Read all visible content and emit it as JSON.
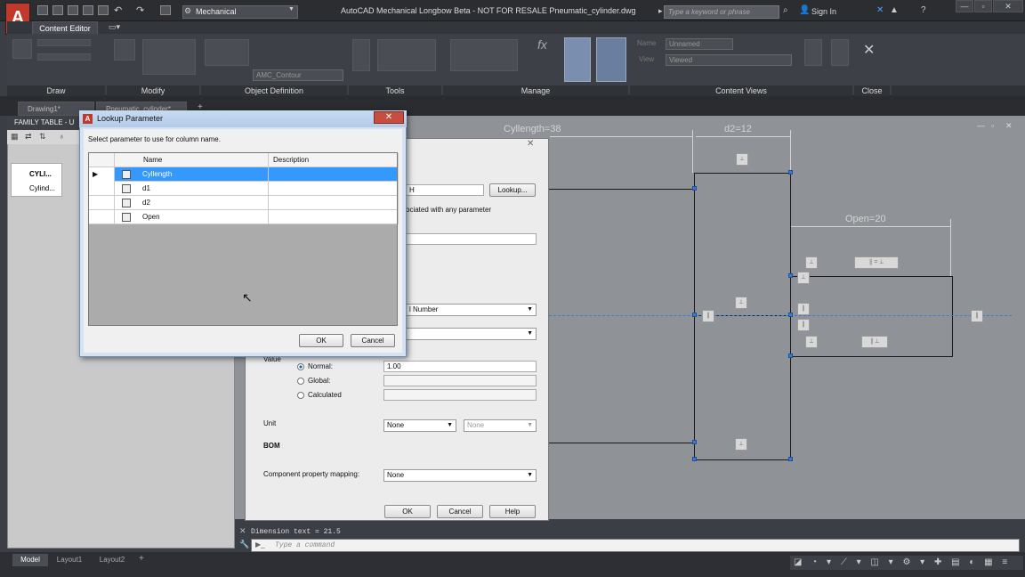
{
  "titlebar": {
    "logo": "A",
    "workspace": "Mechanical",
    "title": "AutoCAD Mechanical Longbow Beta - NOT FOR RESALE      Pneumatic_cylinder.dwg",
    "search_placeholder": "Type a keyword or phrase",
    "sign_in": "Sign In"
  },
  "ribbon": {
    "active_tab": "Content Editor",
    "panels": [
      "Draw",
      "Modify",
      "Object Definition",
      "Tools",
      "Manage",
      "Content Views",
      "Close"
    ],
    "object_definition_value": "AMC_Contour",
    "name_value": "Unnamed",
    "view_value": "Viewed"
  },
  "doc_tabs": [
    "Drawing1*",
    "Pneumatic_cylinder*"
  ],
  "family_table": {
    "header": "FAMILY TABLE - U",
    "items": [
      "CYLI...",
      "Cylind..."
    ]
  },
  "drawing": {
    "dims": [
      "Cyllength=38",
      "d2=12",
      "Open=20"
    ]
  },
  "param_dialog": {
    "lookup_button": "Lookup...",
    "field_suffix": "H",
    "assoc_text": "ociated with any parameter",
    "type_value": "l Number",
    "value_label": "Value",
    "radios": [
      "Normal:",
      "Global:",
      "Calculated"
    ],
    "normal_value": "1.00",
    "unit_label": "Unit",
    "unit_value": "None",
    "unit_sub_value": "None",
    "bom_label": "BOM",
    "mapping_label": "Component property mapping:",
    "mapping_value": "None",
    "ok": "OK",
    "cancel": "Cancel",
    "help": "Help"
  },
  "lookup_dialog": {
    "title": "Lookup Parameter",
    "instruction": "Select parameter to use for column name.",
    "col_name": "Name",
    "col_description": "Description",
    "rows": [
      {
        "name": "Cyllength",
        "description": ""
      },
      {
        "name": "d1",
        "description": ""
      },
      {
        "name": "d2",
        "description": ""
      },
      {
        "name": "Open",
        "description": ""
      }
    ],
    "ok": "OK",
    "cancel": "Cancel"
  },
  "command": {
    "history": "Dimension text = 21.5",
    "placeholder": "Type a command"
  },
  "layout_tabs": [
    "Model",
    "Layout1",
    "Layout2"
  ],
  "colors": {
    "accent": "#3399ff",
    "grip": "#3a7bd5",
    "selected_row": "#3399ff"
  }
}
